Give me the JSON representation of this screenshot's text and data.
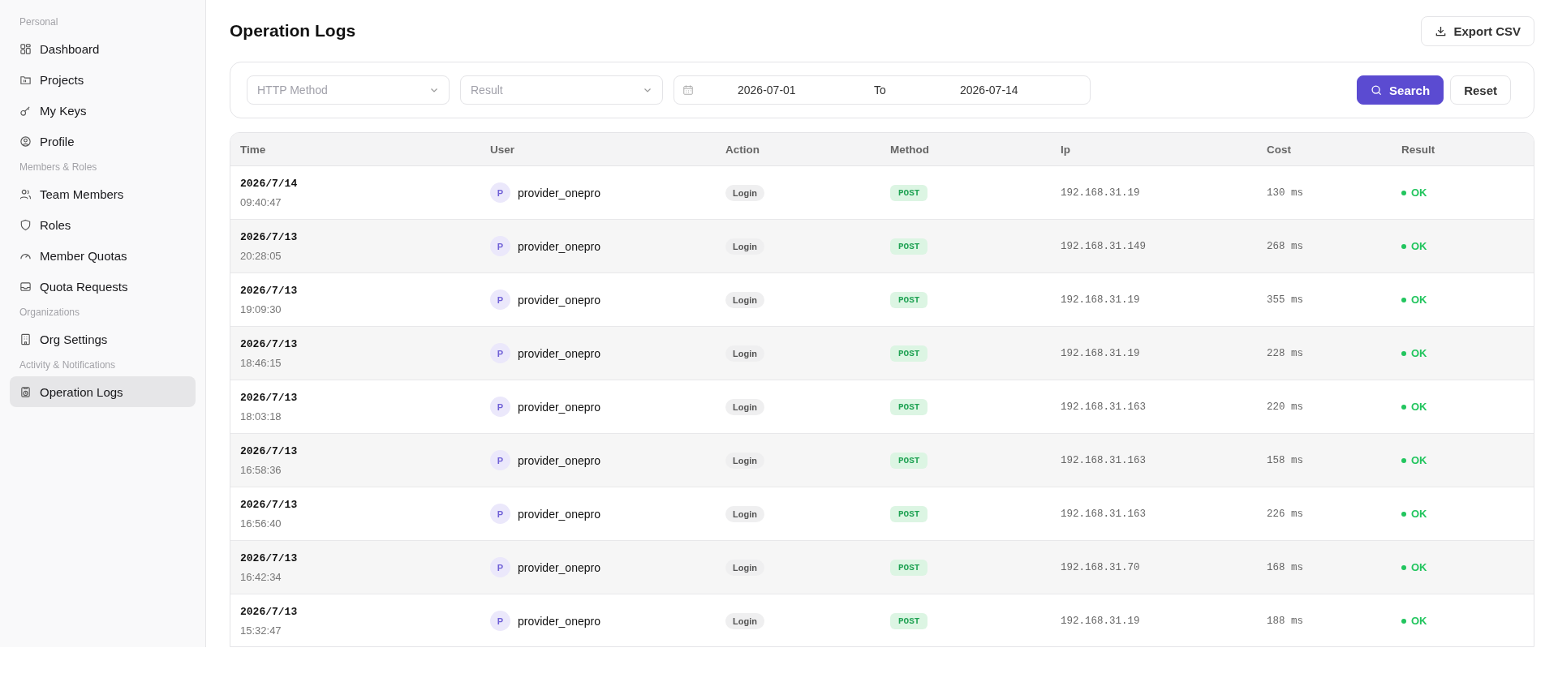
{
  "sidebar": {
    "groups": [
      {
        "heading": "Personal",
        "items": [
          {
            "label": "Dashboard",
            "selected": false
          },
          {
            "label": "Projects",
            "selected": false
          },
          {
            "label": "My Keys",
            "selected": false
          },
          {
            "label": "Profile",
            "selected": false
          }
        ]
      },
      {
        "heading": "Members & Roles",
        "items": [
          {
            "label": "Team Members",
            "selected": false
          },
          {
            "label": "Roles",
            "selected": false
          },
          {
            "label": "Member Quotas",
            "selected": false
          },
          {
            "label": "Quota Requests",
            "selected": false
          }
        ]
      },
      {
        "heading": "Organizations",
        "items": [
          {
            "label": "Org Settings",
            "selected": false
          }
        ]
      },
      {
        "heading": "Activity & Notifications",
        "items": [
          {
            "label": "Operation Logs",
            "selected": true
          }
        ]
      }
    ]
  },
  "page": {
    "title": "Operation Logs",
    "export_button": "Export CSV"
  },
  "filters": {
    "method": {
      "placeholder": "HTTP Method"
    },
    "result": {
      "placeholder": "Result"
    },
    "date_from": "2026-07-01",
    "date_separator": "To",
    "date_to": "2026-07-14",
    "search_button": "Search",
    "reset_button": "Reset"
  },
  "table": {
    "columns": [
      "Time",
      "User",
      "Action",
      "Method",
      "Ip",
      "Cost",
      "Result"
    ],
    "rows": [
      {
        "date": "2026/7/14",
        "time": "09:40:47",
        "avatar": "P",
        "user": "provider_onepro",
        "action": "Login",
        "method": "POST",
        "ip": "192.168.31.19",
        "cost": "130 ms",
        "result": "OK",
        "color": "#22c55e"
      },
      {
        "date": "2026/7/13",
        "time": "20:28:05",
        "avatar": "P",
        "user": "provider_onepro",
        "action": "Login",
        "method": "POST",
        "ip": "192.168.31.149",
        "cost": "268 ms",
        "result": "OK",
        "color": "#22c55e"
      },
      {
        "date": "2026/7/13",
        "time": "19:09:30",
        "avatar": "P",
        "user": "provider_onepro",
        "action": "Login",
        "method": "POST",
        "ip": "192.168.31.19",
        "cost": "355 ms",
        "result": "OK",
        "color": "#22c55e"
      },
      {
        "date": "2026/7/13",
        "time": "18:46:15",
        "avatar": "P",
        "user": "provider_onepro",
        "action": "Login",
        "method": "POST",
        "ip": "192.168.31.19",
        "cost": "228 ms",
        "result": "OK",
        "color": "#22c55e"
      },
      {
        "date": "2026/7/13",
        "time": "18:03:18",
        "avatar": "P",
        "user": "provider_onepro",
        "action": "Login",
        "method": "POST",
        "ip": "192.168.31.163",
        "cost": "220 ms",
        "result": "OK",
        "color": "#22c55e"
      },
      {
        "date": "2026/7/13",
        "time": "16:58:36",
        "avatar": "P",
        "user": "provider_onepro",
        "action": "Login",
        "method": "POST",
        "ip": "192.168.31.163",
        "cost": "158 ms",
        "result": "OK",
        "color": "#22c55e"
      },
      {
        "date": "2026/7/13",
        "time": "16:56:40",
        "avatar": "P",
        "user": "provider_onepro",
        "action": "Login",
        "method": "POST",
        "ip": "192.168.31.163",
        "cost": "226 ms",
        "result": "OK",
        "color": "#22c55e"
      },
      {
        "date": "2026/7/13",
        "time": "16:42:34",
        "avatar": "P",
        "user": "provider_onepro",
        "action": "Login",
        "method": "POST",
        "ip": "192.168.31.70",
        "cost": "168 ms",
        "result": "OK",
        "color": "#22c55e"
      },
      {
        "date": "2026/7/13",
        "time": "15:32:47",
        "avatar": "P",
        "user": "provider_onepro",
        "action": "Login",
        "method": "POST",
        "ip": "192.168.31.19",
        "cost": "188 ms",
        "result": "OK",
        "color": "#22c55e"
      }
    ]
  }
}
